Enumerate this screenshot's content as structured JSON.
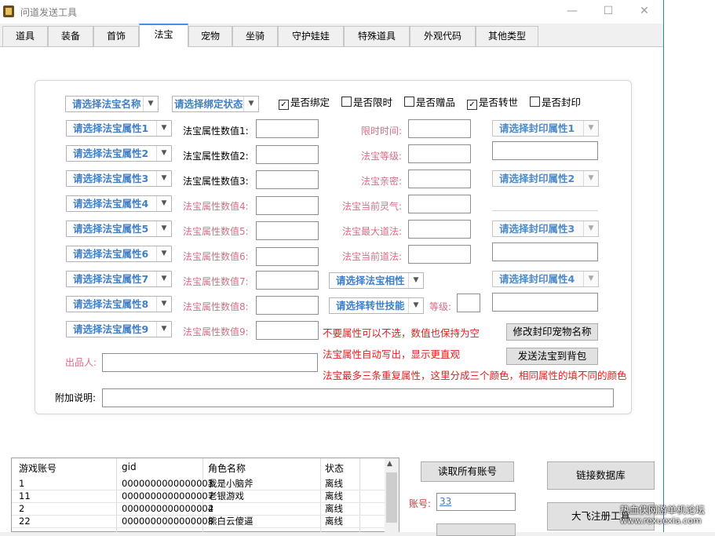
{
  "window": {
    "title": "问道发送工具",
    "controls": {
      "minimize": "—",
      "maximize": "☐",
      "close": "✕"
    }
  },
  "tabs": [
    {
      "label": "道具",
      "active": false
    },
    {
      "label": "装备",
      "active": false
    },
    {
      "label": "首饰",
      "active": false
    },
    {
      "label": "法宝",
      "active": true
    },
    {
      "label": "宠物",
      "active": false
    },
    {
      "label": "坐骑",
      "active": false
    },
    {
      "label": "守护娃娃",
      "active": false
    },
    {
      "label": "特殊道具",
      "active": false
    },
    {
      "label": "外观代码",
      "active": false
    },
    {
      "label": "其他类型",
      "active": false
    }
  ],
  "fabao": {
    "name_select": "请选择法宝名称",
    "bind_select": "请选择绑定状态",
    "checkboxes": [
      {
        "label": "是否绑定",
        "checked": true
      },
      {
        "label": "是否限时",
        "checked": false
      },
      {
        "label": "是否赠品",
        "checked": false
      },
      {
        "label": "是否转世",
        "checked": true
      },
      {
        "label": "是否封印",
        "checked": false
      }
    ],
    "attr_selects": [
      "请选择法宝属性1",
      "请选择法宝属性2",
      "请选择法宝属性3",
      "请选择法宝属性4",
      "请选择法宝属性5",
      "请选择法宝属性6",
      "请选择法宝属性7",
      "请选择法宝属性8",
      "请选择法宝属性9"
    ],
    "attr_value_labels": [
      "法宝属性数值1:",
      "法宝属性数值2:",
      "法宝属性数值3:",
      "法宝属性数值4:",
      "法宝属性数值5:",
      "法宝属性数值6:",
      "法宝属性数值7:",
      "法宝属性数值8:",
      "法宝属性数值9:"
    ],
    "mid_labels": [
      "限时时间:",
      "法宝等级:",
      "法宝亲密:",
      "法宝当前灵气:",
      "法宝最大道法:",
      "法宝当前道法:"
    ],
    "xiangxing_select": "请选择法宝相性",
    "zhuanshi_select": "请选择转世技能",
    "level_label": "等级:",
    "seal_selects": [
      "请选择封印属性1",
      "请选择封印属性2",
      "请选择封印属性3",
      "请选择封印属性4"
    ],
    "notes": [
      "不要属性可以不选，数值也保持为空",
      "法宝属性自动写出，显示更直观",
      "法宝最多三条重复属性，这里分成三个颜色，相同属性的填不同的颜色"
    ],
    "modify_seal_button": "修改封印宠物名称",
    "send_button": "发送法宝到背包",
    "producer_label": "出品人:",
    "extra_label": "附加说明:"
  },
  "accounts_table": {
    "columns": [
      "游戏账号",
      "gid",
      "角色名称",
      "状态"
    ],
    "rows": [
      [
        "1",
        "0000000000000003",
        "我是小脑斧",
        "离线"
      ],
      [
        "11",
        "0000000000000007",
        "老银游戏",
        "离线"
      ],
      [
        "2",
        "0000000000000004",
        "2",
        "离线"
      ],
      [
        "22",
        "0000000000000008",
        "熊白云傻逼",
        "离线"
      ]
    ]
  },
  "account_panel": {
    "read_all_button": "读取所有账号",
    "account_label": "账号:",
    "account_value": "33",
    "connect_db_button": "链接数据库",
    "register_button": "大飞注册工具"
  },
  "watermark": {
    "line1": "热血侠网游单机论坛",
    "line2": "www.rexuexia.com"
  },
  "colors": {
    "select_text": "#3e7fc7",
    "pink_label": "#d66d86",
    "red_note": "#e02020",
    "active_tab_accent": "#4a90d9"
  }
}
